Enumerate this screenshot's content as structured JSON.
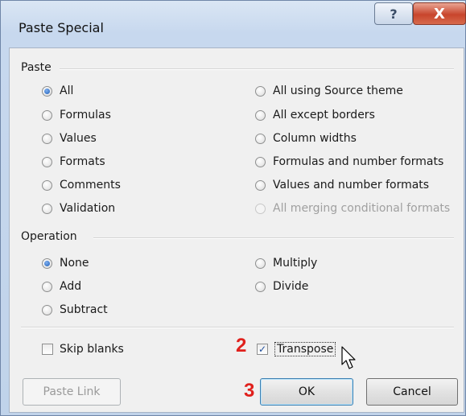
{
  "dialog": {
    "title": "Paste Special",
    "help_label": "?",
    "close_label": "X"
  },
  "paste": {
    "group_label": "Paste",
    "options_left": [
      {
        "label": "All",
        "checked": true
      },
      {
        "label": "Formulas",
        "checked": false
      },
      {
        "label": "Values",
        "checked": false
      },
      {
        "label": "Formats",
        "checked": false
      },
      {
        "label": "Comments",
        "checked": false
      },
      {
        "label": "Validation",
        "checked": false
      }
    ],
    "options_right": [
      {
        "label": "All using Source theme",
        "checked": false
      },
      {
        "label": "All except borders",
        "checked": false
      },
      {
        "label": "Column widths",
        "checked": false
      },
      {
        "label": "Formulas and number formats",
        "checked": false
      },
      {
        "label": "Values and number formats",
        "checked": false
      },
      {
        "label": "All merging conditional formats",
        "checked": false,
        "disabled": true
      }
    ]
  },
  "operation": {
    "group_label": "Operation",
    "options_left": [
      {
        "label": "None",
        "checked": true
      },
      {
        "label": "Add",
        "checked": false
      },
      {
        "label": "Subtract",
        "checked": false
      }
    ],
    "options_right": [
      {
        "label": "Multiply",
        "checked": false
      },
      {
        "label": "Divide",
        "checked": false
      }
    ]
  },
  "checkboxes": {
    "skip_blanks": {
      "label": "Skip blanks",
      "checked": false
    },
    "transpose": {
      "label": "Transpose",
      "checked": true
    }
  },
  "buttons": {
    "paste_link": "Paste Link",
    "ok": "OK",
    "cancel": "Cancel"
  },
  "annotations": {
    "step_2": "2",
    "step_3": "3"
  },
  "icons": {
    "cursor": "mouse-pointer-icon",
    "checkmark": "checkmark-icon"
  }
}
